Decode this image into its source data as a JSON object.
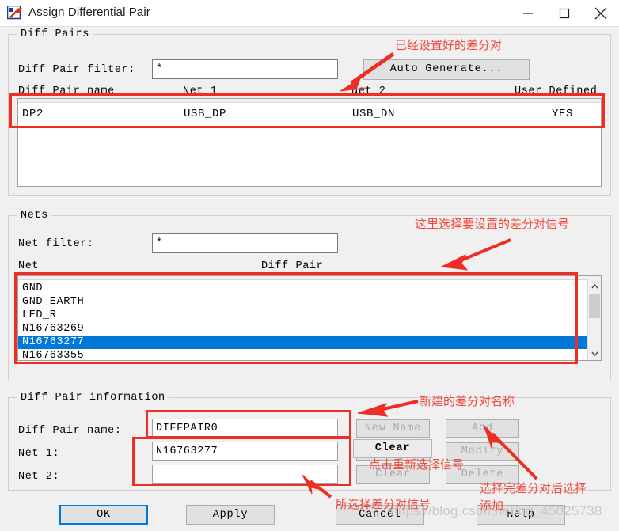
{
  "window": {
    "title": "Assign Differential Pair",
    "icon": "pcb-editor-icon",
    "minimize_label": "–",
    "maximize_label": "□",
    "close_label": "✕"
  },
  "diff_pairs": {
    "group_label": "Diff Pairs",
    "filter_label": "Diff Pair filter:",
    "filter_value": "*",
    "auto_generate_label": "Auto Generate...",
    "columns": [
      "Diff Pair name",
      "Net 1",
      "Net 2",
      "User Defined"
    ],
    "rows": [
      {
        "name": "DP2",
        "net1": "USB_DP",
        "net2": "USB_DN",
        "user_defined": "YES"
      }
    ]
  },
  "nets": {
    "group_label": "Nets",
    "filter_label": "Net filter:",
    "filter_value": "*",
    "columns": [
      "Net",
      "Diff Pair"
    ],
    "items": [
      {
        "name": "GND",
        "diff_pair": "",
        "selected": false
      },
      {
        "name": "GND_EARTH",
        "diff_pair": "",
        "selected": false
      },
      {
        "name": "LED_R",
        "diff_pair": "",
        "selected": false
      },
      {
        "name": "N16763269",
        "diff_pair": "",
        "selected": false
      },
      {
        "name": "N16763277",
        "diff_pair": "",
        "selected": true
      },
      {
        "name": "N16763355",
        "diff_pair": "",
        "selected": false
      }
    ],
    "scroll_up_icon": "chevron-up-icon",
    "scroll_down_icon": "chevron-down-icon"
  },
  "diff_pair_info": {
    "group_label": "Diff Pair information",
    "name_label": "Diff Pair name:",
    "name_value": "DIFFPAIR0",
    "net1_label": "Net 1:",
    "net1_value": "N16763277",
    "net2_label": "Net 2:",
    "net2_value": "",
    "buttons": {
      "new_name": "New Name",
      "clear": "Clear",
      "clear2": "Clear",
      "add": "Add",
      "modify": "Modify",
      "delete": "Delete"
    },
    "clear_callout_label": "Clear"
  },
  "footer": {
    "ok": "OK",
    "apply": "Apply",
    "cancel": "Cancel",
    "help": "Help"
  },
  "annotations": [
    {
      "id": "ann-existing-pair",
      "text": "已经设置好的差分对"
    },
    {
      "id": "ann-select-signal",
      "text": "这里选择要设置的差分对信号"
    },
    {
      "id": "ann-new-name",
      "text": "新建的差分对名称"
    },
    {
      "id": "ann-reselect",
      "text": "点击重新选择信号"
    },
    {
      "id": "ann-chosen-signal",
      "text": "所选择差分对信号"
    },
    {
      "id": "ann-add-after",
      "text": "选择完差分对后选择"
    },
    {
      "id": "ann-add-after-2",
      "text": "添加"
    }
  ],
  "watermark": "https://blog.csdn.net/qq_45025738",
  "colors": {
    "annotation_red": "#f2483e",
    "selection_blue": "#0078d7",
    "dialog_bg": "#f0f0f0"
  }
}
